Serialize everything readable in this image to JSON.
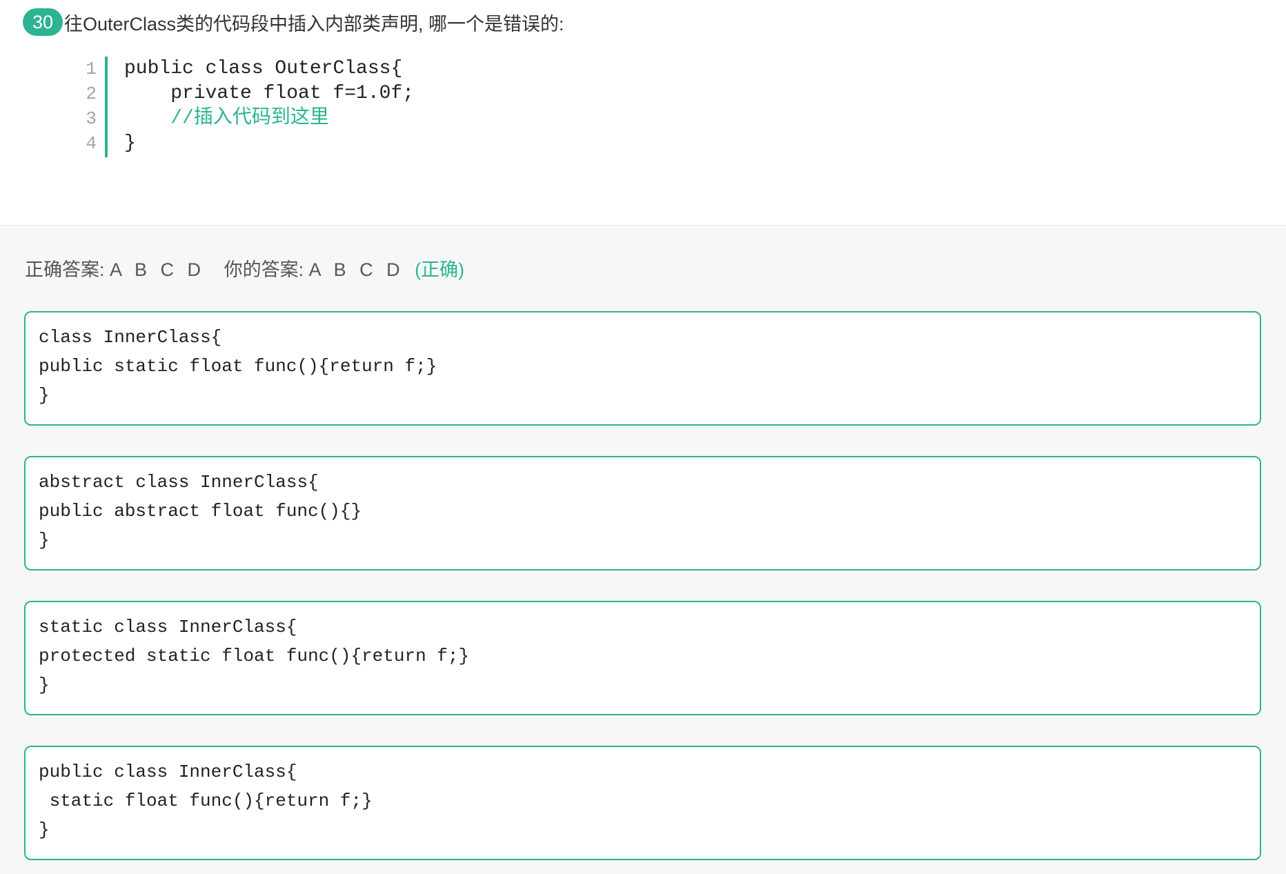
{
  "question": {
    "number": "30",
    "text": "往OuterClass类的代码段中插入内部类声明, 哪一个是错误的:"
  },
  "code": {
    "line_numbers": [
      "1",
      "2",
      "3",
      "4"
    ],
    "lines": [
      "public class OuterClass{",
      "    private float f=1.0f;",
      "    //插入代码到这里",
      "}"
    ]
  },
  "answer": {
    "correct_label": "正确答案:",
    "correct_value": "A B C D",
    "yours_label": "你的答案:",
    "yours_value": "A B C D",
    "result": "(正确)"
  },
  "options": [
    {
      "lines": [
        "class InnerClass{",
        "public static float func(){return f;}",
        "}"
      ]
    },
    {
      "lines": [
        "abstract class InnerClass{",
        "public abstract float func(){}",
        "}"
      ]
    },
    {
      "lines": [
        "static class InnerClass{",
        "protected static float func(){return f;}",
        "}"
      ]
    },
    {
      "lines": [
        "public class InnerClass{",
        " static float func(){return f;}",
        "}"
      ]
    }
  ],
  "colors": {
    "accent": "#2bb393",
    "panel_background": "#f7f7f7"
  }
}
